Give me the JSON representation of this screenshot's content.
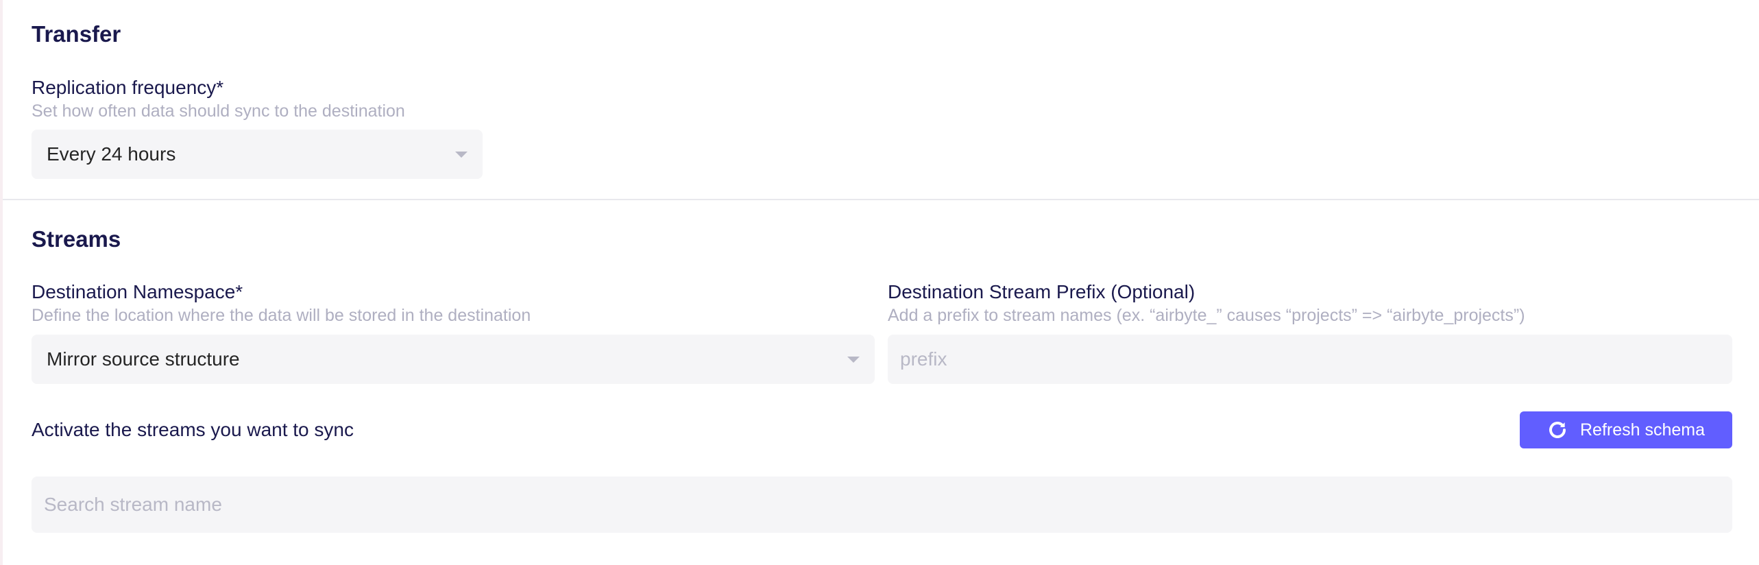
{
  "transfer": {
    "title": "Transfer",
    "replication_frequency": {
      "label": "Replication frequency*",
      "help": "Set how often data should sync to the destination",
      "selected": "Every 24 hours"
    }
  },
  "streams": {
    "title": "Streams",
    "destination_namespace": {
      "label": "Destination Namespace*",
      "help": "Define the location where the data will be stored in the destination",
      "selected": "Mirror source structure"
    },
    "destination_prefix": {
      "label": "Destination Stream Prefix (Optional)",
      "help": "Add a prefix to stream names (ex. “airbyte_” causes “projects” => “airbyte_projects”)",
      "placeholder": "prefix",
      "value": ""
    },
    "activate_label": "Activate the streams you want to sync",
    "refresh_button": {
      "label": "Refresh schema",
      "icon": "refresh-icon",
      "color": "#615eff"
    },
    "search": {
      "placeholder": "Search stream name",
      "value": ""
    }
  },
  "colors": {
    "heading": "#1a194d",
    "help_text": "#afafc1",
    "input_background": "#f5f5f7",
    "accent": "#615eff"
  }
}
